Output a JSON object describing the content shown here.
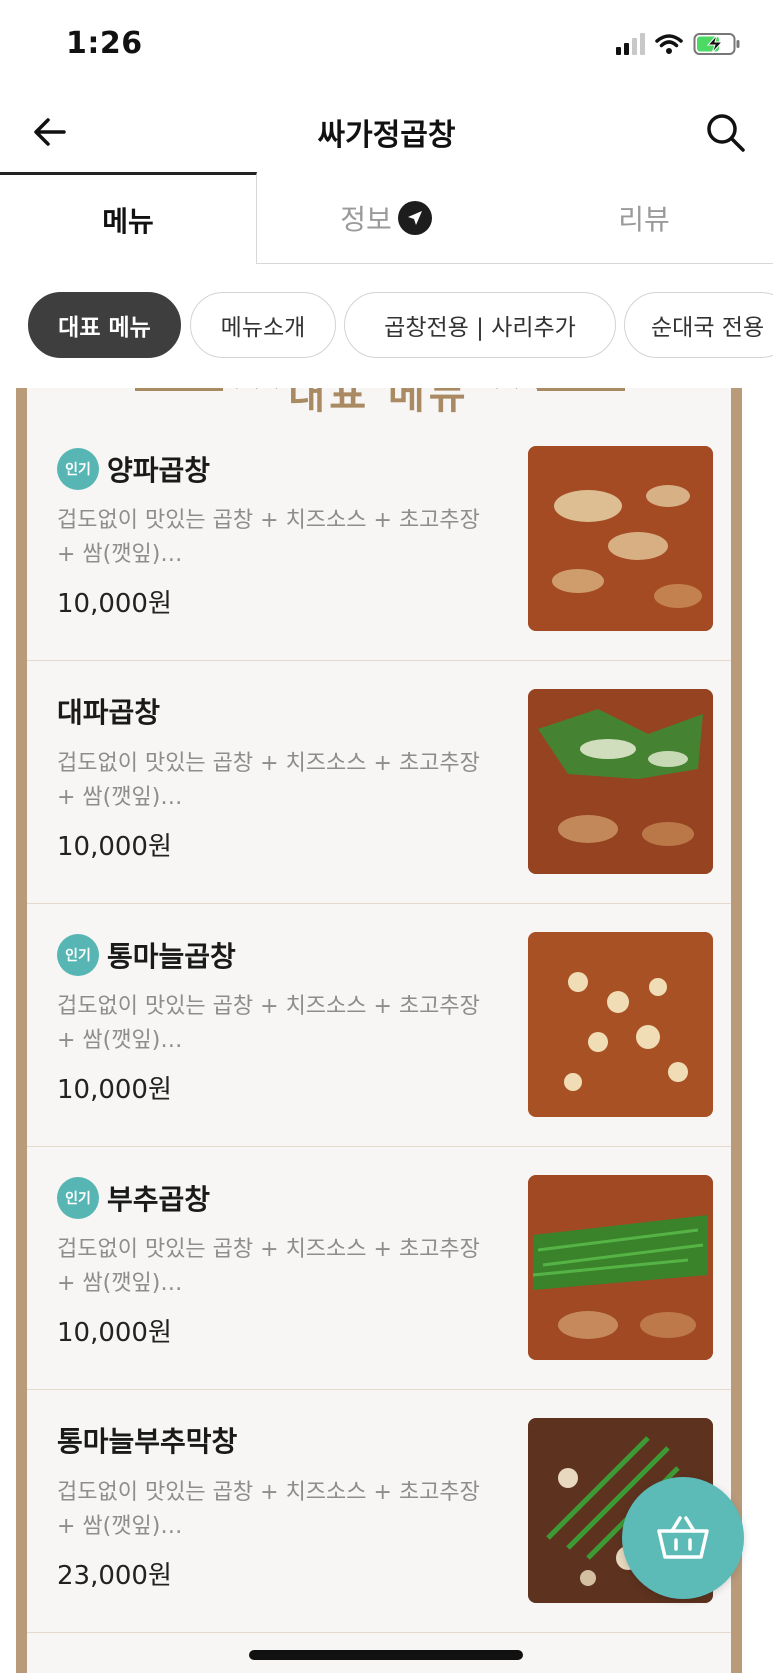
{
  "status_bar": {
    "time": "1:26"
  },
  "header": {
    "title": "싸가정곱창"
  },
  "tabs": [
    {
      "label": "메뉴"
    },
    {
      "label": "정보"
    },
    {
      "label": "리뷰"
    }
  ],
  "chips": [
    {
      "label": "대표 메뉴"
    },
    {
      "label": "메뉴소개"
    },
    {
      "label": "곱창전용 | 사리추가"
    },
    {
      "label": "순대국 전용"
    }
  ],
  "section": {
    "banner": "대표 메뉴",
    "deco_left": "♦♦♦",
    "deco_right": "♦♦♦"
  },
  "badge_label": "인기",
  "menu_items": [
    {
      "name": "양파곱창",
      "popular": true,
      "desc": "겁도없이 맛있는 곱창 + 치즈소스 + 초고추장 + 쌈(깻잎)…",
      "price": "10,000원"
    },
    {
      "name": "대파곱창",
      "popular": false,
      "desc": "겁도없이 맛있는 곱창 + 치즈소스 + 초고추장 + 쌈(깻잎)…",
      "price": "10,000원"
    },
    {
      "name": "통마늘곱창",
      "popular": true,
      "desc": "겁도없이 맛있는 곱창 + 치즈소스 + 초고추장 + 쌈(깻잎)…",
      "price": "10,000원"
    },
    {
      "name": "부추곱창",
      "popular": true,
      "desc": "겁도없이 맛있는 곱창 + 치즈소스 + 초고추장 + 쌈(깻잎)…",
      "price": "10,000원"
    },
    {
      "name": "통마늘부추막창",
      "popular": false,
      "desc": "겁도없이 맛있는 곱창 + 치즈소스 + 초고추장 + 쌈(깻잎)…",
      "price": "23,000원"
    }
  ],
  "colors": {
    "accent": "#5cbab7",
    "frame": "#b99b7a",
    "banner": "#a98a63"
  }
}
